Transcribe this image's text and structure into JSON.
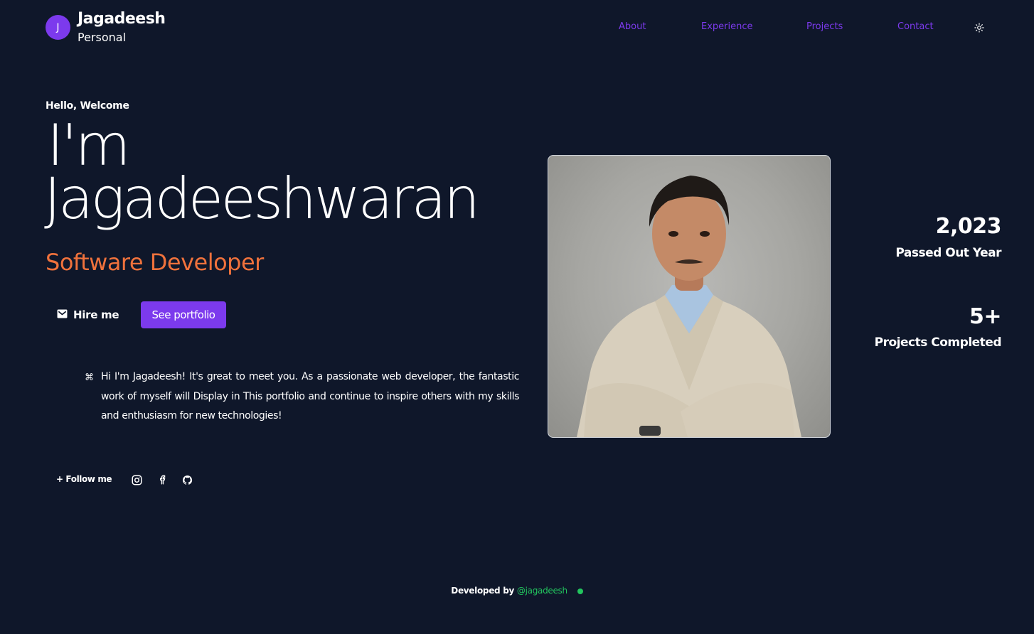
{
  "header": {
    "logo_letter": "J",
    "brand_name": "Jagadeesh",
    "brand_sub": "Personal",
    "nav": [
      "About",
      "Experience",
      "Projects",
      "Contact"
    ],
    "theme_icon": "sun-icon"
  },
  "hero": {
    "greeting": "Hello, Welcome",
    "line1": "I'm",
    "line2": "Jagadeeshwaran",
    "role": "Software Developer",
    "hire_label": "Hire me",
    "portfolio_label": "See portfolio",
    "intro": "Hi I'm Jagadeesh! It's great to meet you. As a passionate web developer, the fantastic work of myself will Display in This portfolio and continue to inspire others with my skills and enthusiasm for new technologies!",
    "follow_label": "+ Follow me",
    "socials": [
      "instagram-icon",
      "facebook-icon",
      "github-icon"
    ]
  },
  "stats": [
    {
      "value": "2,023",
      "label": "Passed Out Year"
    },
    {
      "value": "5+",
      "label": "Projects Completed"
    }
  ],
  "footer": {
    "prefix": "Developed by",
    "handle": "@jagadeesh"
  },
  "colors": {
    "background": "#0f172a",
    "accent": "#7c3aed",
    "role": "#f0723c",
    "status": "#22c55e"
  }
}
